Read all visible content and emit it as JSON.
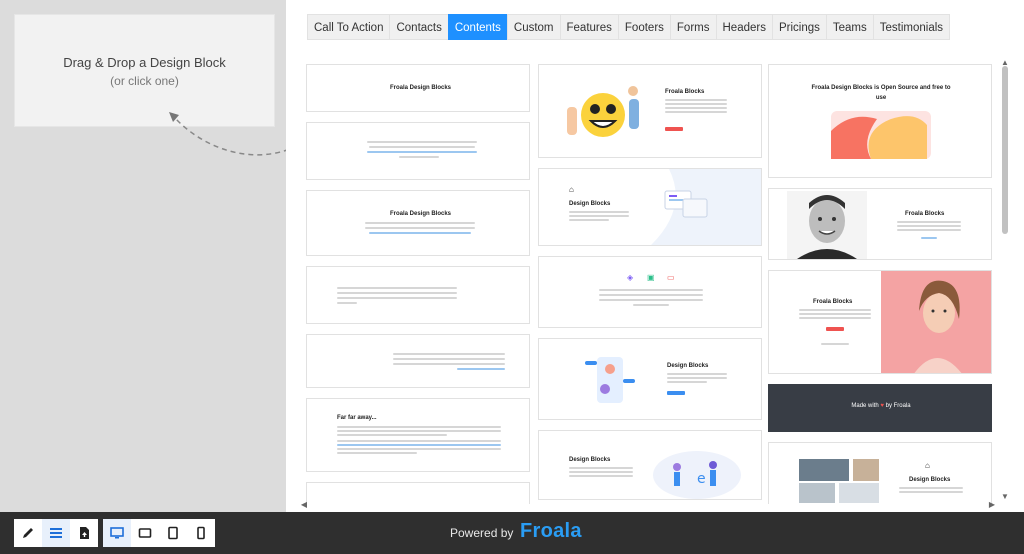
{
  "drop_zone": {
    "title": "Drag & Drop a Design Block",
    "subtitle": "(or click one)"
  },
  "tabs": [
    {
      "label": "Call To Action",
      "active": false
    },
    {
      "label": "Contacts",
      "active": false
    },
    {
      "label": "Contents",
      "active": true
    },
    {
      "label": "Custom",
      "active": false
    },
    {
      "label": "Features",
      "active": false
    },
    {
      "label": "Footers",
      "active": false
    },
    {
      "label": "Forms",
      "active": false
    },
    {
      "label": "Headers",
      "active": false
    },
    {
      "label": "Pricings",
      "active": false
    },
    {
      "label": "Teams",
      "active": false
    },
    {
      "label": "Testimonials",
      "active": false
    }
  ],
  "blocks": {
    "col1": {
      "b1_title": "Froala Design Blocks",
      "b3_title": "Froala Design Blocks",
      "b6_title": "Far far away..."
    },
    "col2": {
      "b1_title": "Froala Blocks",
      "b2_title": "Design Blocks",
      "b4_title": "Design Blocks",
      "b5_title": "Design Blocks"
    },
    "col3": {
      "b1_title": "Froala Design Blocks is Open Source and free to use",
      "b2_title": "Froala Blocks",
      "b3_title": "Froala Blocks",
      "b4_text_pre": "Made with",
      "b4_text_post": "by Froala",
      "b5_title": "Design Blocks"
    }
  },
  "footer": {
    "powered_label": "Powered by",
    "brand": "Froala"
  },
  "colors": {
    "accent": "#1e90ff",
    "footer_bg": "#2f2f2f",
    "brand": "#2a9df4"
  }
}
